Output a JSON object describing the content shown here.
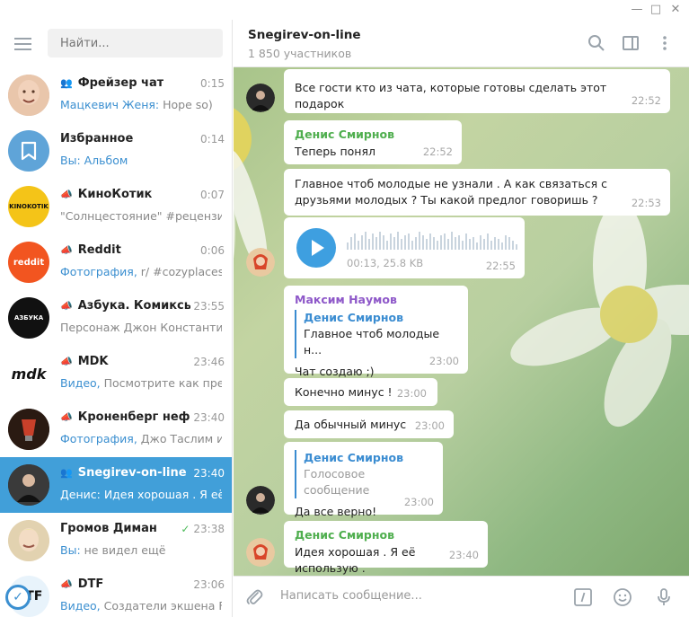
{
  "window": {
    "minimize": "—",
    "maximize": "□",
    "close": "✕"
  },
  "search": {
    "placeholder": "Найти..."
  },
  "chats": [
    {
      "name": "Фрейзер чат",
      "time": "0:15",
      "prefix": "Мацкевич Женя:",
      "text": " Hope so)",
      "type": "group",
      "avatar_color": "#d7b49a"
    },
    {
      "name": "Избранное",
      "time": "0:14",
      "prefix": "Вы:",
      "text": " Альбом",
      "type": "",
      "avatar_color": "#5fa4d8"
    },
    {
      "name": "КиноКотик",
      "time": "0:07",
      "prefix": "",
      "text": "\"Солнцестояние\" #рецензи...",
      "type": "channel",
      "avatar_color": "#f4c418",
      "avatar_text": "KINOKOTIK"
    },
    {
      "name": "Reddit",
      "time": "0:06",
      "prefix": "Фотография,",
      "text": " r/ #cozyplaces ...",
      "type": "channel",
      "avatar_color": "#f25520",
      "avatar_text": "reddit"
    },
    {
      "name": "Азбука. Комиксы...",
      "time": "23:55",
      "prefix": "",
      "text": "Персонаж Джон Константи...",
      "type": "channel",
      "avatar_color": "#111111",
      "avatar_text": "АЗБУКА"
    },
    {
      "name": "MDK",
      "time": "23:46",
      "prefix": "Видео,",
      "text": " Посмотрите как пре...",
      "type": "channel",
      "avatar_color": "#ffffff",
      "avatar_text": "mdk"
    },
    {
      "name": "Кроненберг неф...",
      "time": "23:40",
      "prefix": "Фотография,",
      "text": " Джо Таслим и...",
      "type": "channel",
      "avatar_color": "#2a1a12"
    },
    {
      "name": "Snegirev-on-line",
      "time": "23:40",
      "prefix": "Денис:",
      "text": " Идея хорошая . Я её ...",
      "type": "group",
      "avatar_color": "#2b2b2b",
      "active": true
    },
    {
      "name": "Громов Диман",
      "time": "23:38",
      "prefix": "Вы:",
      "text": " не видел ещё",
      "type": "",
      "avatar_color": "#e9d9b8",
      "read": true
    },
    {
      "name": "DTF",
      "time": "23:06",
      "prefix": "Видео,",
      "text": " Создатели экшена F...",
      "type": "channel",
      "avatar_color": "#ffffff",
      "avatar_text": "DTF"
    }
  ],
  "header": {
    "title": "Snegirev-on-line",
    "subtitle": "1 850 участников"
  },
  "messages": [
    {
      "id": "m1",
      "sender": "",
      "text": "Все гости кто из чата, которые готовы сделать этот подарок",
      "time": "22:52"
    },
    {
      "id": "m2",
      "sender": "Денис Смирнов",
      "text": "Теперь понял",
      "time": "22:52"
    },
    {
      "id": "m3",
      "sender": "",
      "text": "Главное чтоб молодые не узнали . А как связаться с друзьями молодых ? Ты какой предлог говоришь ?",
      "time": "22:53"
    },
    {
      "id": "m4",
      "voice": {
        "duration": "00:13, 25.8 KB"
      },
      "time": "22:55"
    },
    {
      "id": "m5",
      "sender": "Максим Наумов",
      "reply_name": "Денис Смирнов",
      "reply_text": "Главное чтоб молодые н...",
      "text": "Чат создаю ;)",
      "time": "23:00"
    },
    {
      "id": "m6",
      "text": "Конечно минус !",
      "time": "23:00"
    },
    {
      "id": "m7",
      "text": "Да обычный минус",
      "time": "23:00"
    },
    {
      "id": "m8",
      "reply_name": "Денис Смирнов",
      "reply_text": "Голосовое сообщение",
      "text": "Да все верно!",
      "time": "23:00"
    },
    {
      "id": "m9",
      "sender": "Денис Смирнов",
      "text": "Идея хорошая . Я её использую .",
      "time": "23:40"
    }
  ],
  "composer": {
    "placeholder": "Написать сообщение..."
  },
  "colors": {
    "accent": "#419fd9",
    "green_sender": "#4fae4e",
    "purple_sender": "#8e58c9"
  }
}
